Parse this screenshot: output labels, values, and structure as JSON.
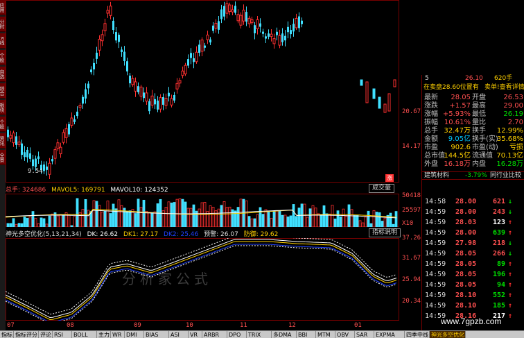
{
  "left_tabs": [
    "应用",
    "分时",
    "K线",
    "个股",
    "自选",
    "综合",
    "板块",
    "个股",
    "资讯",
    "全景"
  ],
  "price_axis": [
    "20.67",
    "14.17"
  ],
  "price_low_label": "9.54",
  "limit_marker": "涨",
  "volume_header": {
    "total": "总手: 324686",
    "mavol5": "MAVOL5: 169791",
    "mavol10": "MAVOL10: 124352",
    "selector": "成交量"
  },
  "volume_axis": [
    "50418",
    "25597",
    "X10"
  ],
  "indicator_header": {
    "name": "神光多空优化(5,13,21,34)",
    "dk": "DK: 26.62",
    "dk1": "DK1: 27.17",
    "dk2": "DK2: 25.46",
    "warn": "预警: 26.07",
    "defense": "防御: 29.62",
    "button": "指标说明"
  },
  "indicator_axis": [
    "37.26",
    "31.67",
    "25.94",
    "20.34"
  ],
  "x_axis_months": [
    "07",
    "08",
    "09",
    "10",
    "11",
    "12",
    "01"
  ],
  "watermark": "分析家公式",
  "site": "www.7gpzb.com",
  "quote_header": {
    "top_left": "5",
    "top_mid": "26.10",
    "top_right": "620手",
    "bar_left": "在卖盘28.60位置有",
    "bar_right": "卖单!查看详情"
  },
  "quote_rows": [
    {
      "l1": "最新",
      "v1": "28.05",
      "c1": "#ff5050",
      "l2": "开盘",
      "v2": "26.53",
      "c2": "#ff5050"
    },
    {
      "l1": "涨跌",
      "v1": "+1.57",
      "c1": "#ff5050",
      "l2": "最高",
      "v2": "29.00",
      "c2": "#ff5050"
    },
    {
      "l1": "涨幅",
      "v1": "+5.93%",
      "c1": "#ff5050",
      "l2": "最低",
      "v2": "26.19",
      "c2": "#00e000"
    },
    {
      "l1": "振幅",
      "v1": "10.61%",
      "c1": "#ff5050",
      "l2": "量比",
      "v2": "2.70",
      "c2": "#ff5050"
    },
    {
      "l1": "总手",
      "v1": "32.47万",
      "c1": "#ffd000",
      "l2": "换手",
      "v2": "12.99%",
      "c2": "#ffd000"
    },
    {
      "l1": "金额",
      "v1": "9.05亿",
      "c1": "#00c8ff",
      "l2": "换手(实)",
      "v2": "35.68%",
      "c2": "#ffd000"
    },
    {
      "l1": "市盈",
      "v1": "902.6",
      "c1": "#ffd000",
      "l2": "市盈(动)",
      "v2": "亏损",
      "c2": "#ffd000"
    },
    {
      "l1": "总市值",
      "v1": "144.5亿",
      "c1": "#ffd000",
      "l2": "流通值",
      "v2": "70.13亿",
      "c2": "#ffd000"
    },
    {
      "l1": "外盘",
      "v1": "16.18万",
      "c1": "#ff5050",
      "l2": "内盘",
      "v2": "16.28万",
      "c2": "#00e000"
    }
  ],
  "sector": {
    "name": "建筑材料",
    "change": "-3.79%",
    "compare": "同行业比较"
  },
  "ticks": [
    {
      "time": "14:58",
      "price": "28.00",
      "vol": "621",
      "dir": "down"
    },
    {
      "time": "14:59",
      "price": "28.00",
      "vol": "243",
      "dir": "down"
    },
    {
      "time": "14:59",
      "price": "28.03",
      "vol": "123",
      "dir": "up"
    },
    {
      "time": "14:59",
      "price": "28.00",
      "vol": "639",
      "dir": "up"
    },
    {
      "time": "14:59",
      "price": "27.98",
      "vol": "218",
      "dir": "down"
    },
    {
      "time": "14:59",
      "price": "28.05",
      "vol": "266",
      "dir": "down"
    },
    {
      "time": "14:59",
      "price": "28.05",
      "vol": "89",
      "dir": "up"
    },
    {
      "time": "14:59",
      "price": "28.05",
      "vol": "196",
      "dir": "up"
    },
    {
      "time": "14:59",
      "price": "28.05",
      "vol": "94",
      "dir": "up"
    },
    {
      "time": "14:59",
      "price": "28.10",
      "vol": "552",
      "dir": "up"
    },
    {
      "time": "14:59",
      "price": "28.10",
      "vol": "185",
      "dir": "up"
    },
    {
      "time": "14:59",
      "price": "28.16",
      "vol": "217",
      "dir": "up"
    }
  ],
  "bottom_tabs": [
    "指标",
    "指标评分",
    "评论",
    "RSI",
    "BOLL",
    "主力",
    "WR",
    "DMI",
    "BIAS",
    "ASI",
    "VR",
    "ARBR",
    "DPO",
    "TRIX",
    "多DMA",
    "BBI",
    "MTM",
    "OBV",
    "SAR",
    "EXPMA",
    "四季中线",
    "神光多空优化"
  ],
  "colors": {
    "up": "#ff3030",
    "down": "#40e0ff",
    "border": "#7a0000",
    "dk": "#ffffff",
    "dk1": "#ffd000",
    "dk2": "#2040ff"
  }
}
